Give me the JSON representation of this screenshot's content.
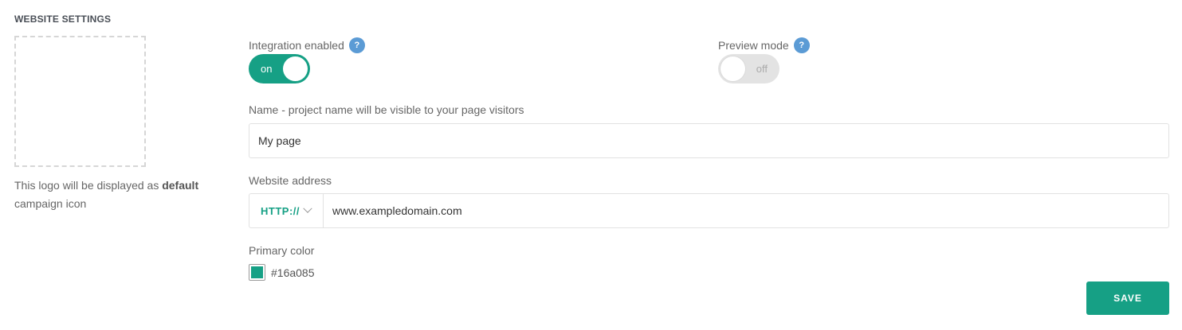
{
  "section": {
    "title": "WEBSITE SETTINGS"
  },
  "logo": {
    "note_prefix": "This logo will be displayed as ",
    "note_bold": "default",
    "note_suffix": " campaign icon"
  },
  "integration": {
    "label": "Integration enabled",
    "help": "?",
    "state": "on"
  },
  "preview": {
    "label": "Preview mode",
    "help": "?",
    "state": "off"
  },
  "name_field": {
    "label": "Name - project name will be visible to your page visitors",
    "value": "My page"
  },
  "address_field": {
    "label": "Website address",
    "protocol": "HTTP://",
    "value": "www.exampledomain.com"
  },
  "primary_color": {
    "label": "Primary color",
    "value": "#16a085"
  },
  "actions": {
    "save": "SAVE"
  },
  "colors": {
    "accent": "#16a085",
    "help_icon": "#5b9bd5"
  }
}
